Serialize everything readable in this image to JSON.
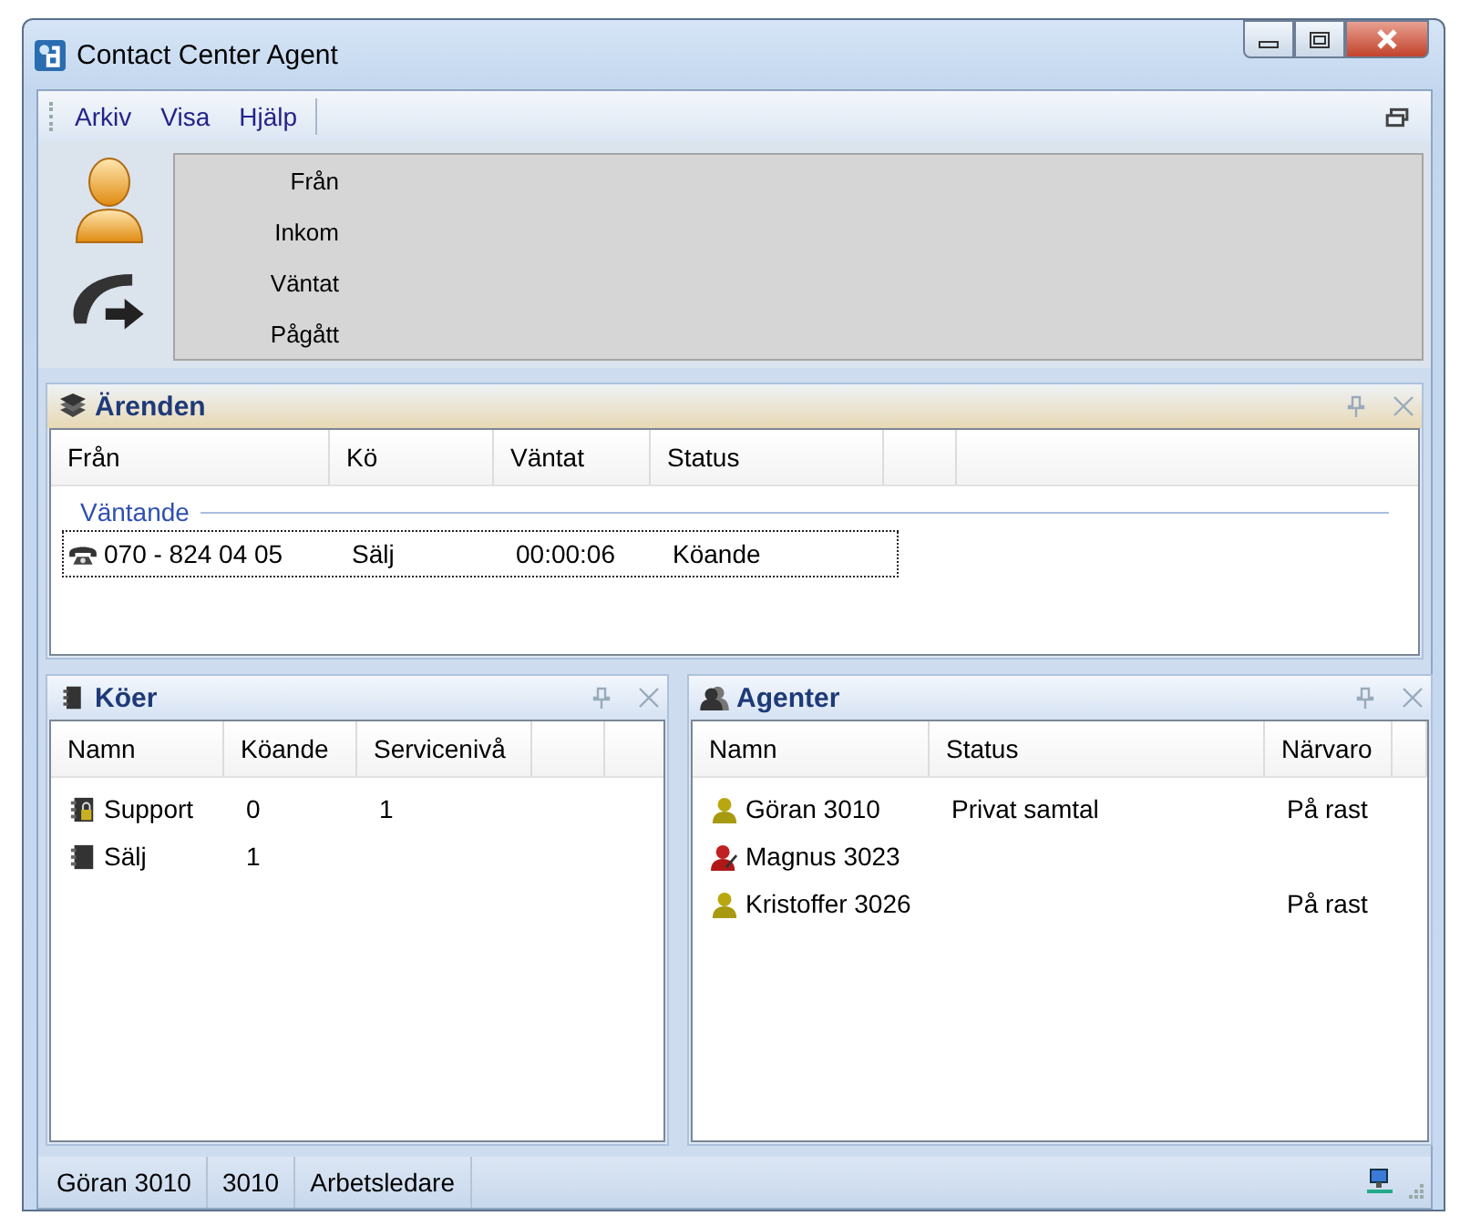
{
  "window": {
    "title": "Contact Center Agent"
  },
  "menu": [
    {
      "label": "Arkiv"
    },
    {
      "label": "Visa"
    },
    {
      "label": "Hjälp"
    }
  ],
  "caller": {
    "fields": [
      {
        "label": "Från"
      },
      {
        "label": "Inkom"
      },
      {
        "label": "Väntat"
      },
      {
        "label": "Pågått"
      }
    ]
  },
  "cases": {
    "title": "Ärenden",
    "active": true,
    "columns": [
      "Från",
      "Kö",
      "Väntat",
      "Status"
    ],
    "groups": [
      {
        "title": "Väntande",
        "rows": [
          {
            "cells": [
              "070 - 824 04 05",
              "Sälj",
              "00:00:06",
              "Köande"
            ],
            "selected": true
          }
        ]
      }
    ]
  },
  "queues": {
    "title": "Köer",
    "active": false,
    "columns": [
      "Namn",
      "Köande",
      "Servicenivå"
    ],
    "rows": [
      {
        "kind": "locked",
        "cells": [
          "Support",
          "0",
          "1"
        ]
      },
      {
        "kind": "plain",
        "cells": [
          "Sälj",
          "1",
          ""
        ]
      }
    ]
  },
  "agents": {
    "title": "Agenter",
    "active": false,
    "columns": [
      "Namn",
      "Status",
      "Närvaro"
    ],
    "rows": [
      {
        "kind": "available",
        "cells": [
          "Göran 3010",
          "Privat samtal",
          "På rast"
        ]
      },
      {
        "kind": "busy",
        "cells": [
          "Magnus 3023",
          "",
          ""
        ]
      },
      {
        "kind": "available",
        "cells": [
          "Kristoffer 3026",
          "",
          "På rast"
        ]
      }
    ]
  },
  "status_bar": [
    "Göran 3010",
    "3010",
    "Arbetsledare"
  ]
}
